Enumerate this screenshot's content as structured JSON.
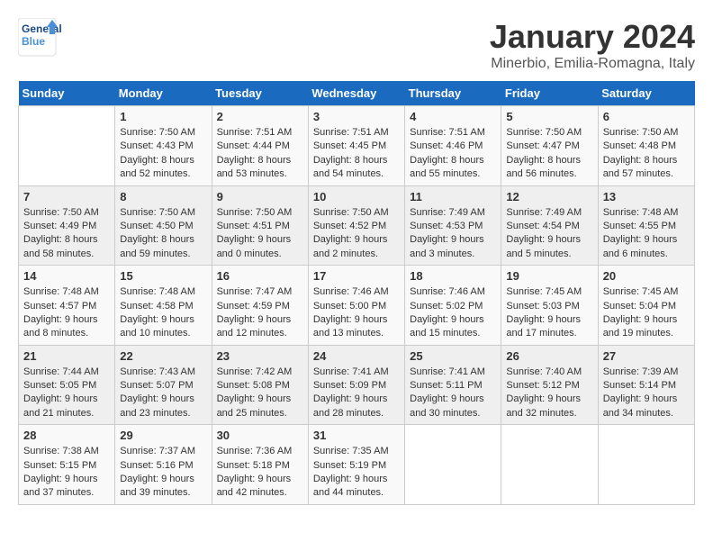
{
  "header": {
    "logo_text_general": "General",
    "logo_text_blue": "Blue",
    "month_title": "January 2024",
    "location": "Minerbio, Emilia-Romagna, Italy"
  },
  "days_of_week": [
    "Sunday",
    "Monday",
    "Tuesday",
    "Wednesday",
    "Thursday",
    "Friday",
    "Saturday"
  ],
  "weeks": [
    [
      {
        "day": "",
        "info": ""
      },
      {
        "day": "1",
        "info": "Sunrise: 7:50 AM\nSunset: 4:43 PM\nDaylight: 8 hours\nand 52 minutes."
      },
      {
        "day": "2",
        "info": "Sunrise: 7:51 AM\nSunset: 4:44 PM\nDaylight: 8 hours\nand 53 minutes."
      },
      {
        "day": "3",
        "info": "Sunrise: 7:51 AM\nSunset: 4:45 PM\nDaylight: 8 hours\nand 54 minutes."
      },
      {
        "day": "4",
        "info": "Sunrise: 7:51 AM\nSunset: 4:46 PM\nDaylight: 8 hours\nand 55 minutes."
      },
      {
        "day": "5",
        "info": "Sunrise: 7:50 AM\nSunset: 4:47 PM\nDaylight: 8 hours\nand 56 minutes."
      },
      {
        "day": "6",
        "info": "Sunrise: 7:50 AM\nSunset: 4:48 PM\nDaylight: 8 hours\nand 57 minutes."
      }
    ],
    [
      {
        "day": "7",
        "info": "Sunrise: 7:50 AM\nSunset: 4:49 PM\nDaylight: 8 hours\nand 58 minutes."
      },
      {
        "day": "8",
        "info": "Sunrise: 7:50 AM\nSunset: 4:50 PM\nDaylight: 8 hours\nand 59 minutes."
      },
      {
        "day": "9",
        "info": "Sunrise: 7:50 AM\nSunset: 4:51 PM\nDaylight: 9 hours\nand 0 minutes."
      },
      {
        "day": "10",
        "info": "Sunrise: 7:50 AM\nSunset: 4:52 PM\nDaylight: 9 hours\nand 2 minutes."
      },
      {
        "day": "11",
        "info": "Sunrise: 7:49 AM\nSunset: 4:53 PM\nDaylight: 9 hours\nand 3 minutes."
      },
      {
        "day": "12",
        "info": "Sunrise: 7:49 AM\nSunset: 4:54 PM\nDaylight: 9 hours\nand 5 minutes."
      },
      {
        "day": "13",
        "info": "Sunrise: 7:48 AM\nSunset: 4:55 PM\nDaylight: 9 hours\nand 6 minutes."
      }
    ],
    [
      {
        "day": "14",
        "info": "Sunrise: 7:48 AM\nSunset: 4:57 PM\nDaylight: 9 hours\nand 8 minutes."
      },
      {
        "day": "15",
        "info": "Sunrise: 7:48 AM\nSunset: 4:58 PM\nDaylight: 9 hours\nand 10 minutes."
      },
      {
        "day": "16",
        "info": "Sunrise: 7:47 AM\nSunset: 4:59 PM\nDaylight: 9 hours\nand 12 minutes."
      },
      {
        "day": "17",
        "info": "Sunrise: 7:46 AM\nSunset: 5:00 PM\nDaylight: 9 hours\nand 13 minutes."
      },
      {
        "day": "18",
        "info": "Sunrise: 7:46 AM\nSunset: 5:02 PM\nDaylight: 9 hours\nand 15 minutes."
      },
      {
        "day": "19",
        "info": "Sunrise: 7:45 AM\nSunset: 5:03 PM\nDaylight: 9 hours\nand 17 minutes."
      },
      {
        "day": "20",
        "info": "Sunrise: 7:45 AM\nSunset: 5:04 PM\nDaylight: 9 hours\nand 19 minutes."
      }
    ],
    [
      {
        "day": "21",
        "info": "Sunrise: 7:44 AM\nSunset: 5:05 PM\nDaylight: 9 hours\nand 21 minutes."
      },
      {
        "day": "22",
        "info": "Sunrise: 7:43 AM\nSunset: 5:07 PM\nDaylight: 9 hours\nand 23 minutes."
      },
      {
        "day": "23",
        "info": "Sunrise: 7:42 AM\nSunset: 5:08 PM\nDaylight: 9 hours\nand 25 minutes."
      },
      {
        "day": "24",
        "info": "Sunrise: 7:41 AM\nSunset: 5:09 PM\nDaylight: 9 hours\nand 28 minutes."
      },
      {
        "day": "25",
        "info": "Sunrise: 7:41 AM\nSunset: 5:11 PM\nDaylight: 9 hours\nand 30 minutes."
      },
      {
        "day": "26",
        "info": "Sunrise: 7:40 AM\nSunset: 5:12 PM\nDaylight: 9 hours\nand 32 minutes."
      },
      {
        "day": "27",
        "info": "Sunrise: 7:39 AM\nSunset: 5:14 PM\nDaylight: 9 hours\nand 34 minutes."
      }
    ],
    [
      {
        "day": "28",
        "info": "Sunrise: 7:38 AM\nSunset: 5:15 PM\nDaylight: 9 hours\nand 37 minutes."
      },
      {
        "day": "29",
        "info": "Sunrise: 7:37 AM\nSunset: 5:16 PM\nDaylight: 9 hours\nand 39 minutes."
      },
      {
        "day": "30",
        "info": "Sunrise: 7:36 AM\nSunset: 5:18 PM\nDaylight: 9 hours\nand 42 minutes."
      },
      {
        "day": "31",
        "info": "Sunrise: 7:35 AM\nSunset: 5:19 PM\nDaylight: 9 hours\nand 44 minutes."
      },
      {
        "day": "",
        "info": ""
      },
      {
        "day": "",
        "info": ""
      },
      {
        "day": "",
        "info": ""
      }
    ]
  ]
}
